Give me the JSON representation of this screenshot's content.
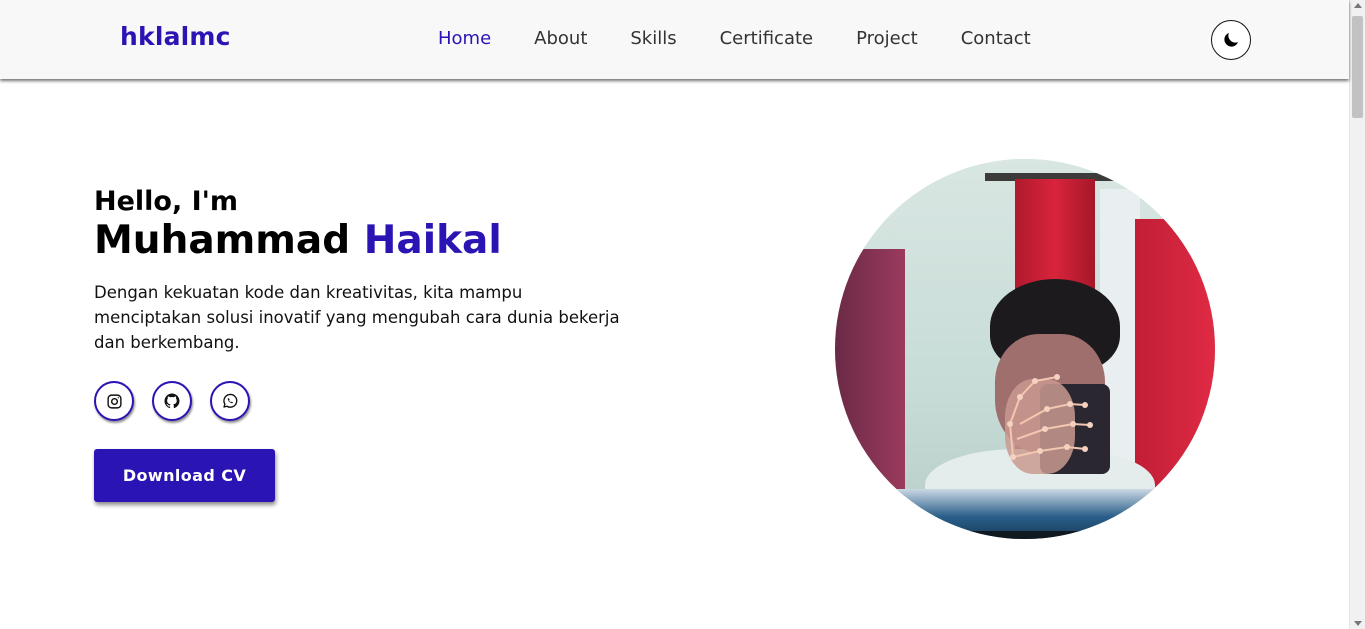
{
  "header": {
    "logo": "hklalmc",
    "nav": {
      "home": "Home",
      "about": "About",
      "skills": "Skills",
      "certificate": "Certificate",
      "project": "Project",
      "contact": "Contact"
    },
    "theme_toggle_icon": "moon-icon"
  },
  "hero": {
    "greeting": "Hello, I'm",
    "name_first": "Muhammad",
    "name_accent": "Haikal",
    "description": "Dengan kekuatan kode dan kreativitas, kita mampu menciptakan solusi inovatif yang mengubah cara dunia bekerja dan berkembang.",
    "socials": [
      "instagram-icon",
      "github-icon",
      "whatsapp-icon"
    ],
    "download_label": "Download CV"
  },
  "colors": {
    "accent": "#2a14b4",
    "text": "#111111",
    "background": "#ffffff"
  }
}
